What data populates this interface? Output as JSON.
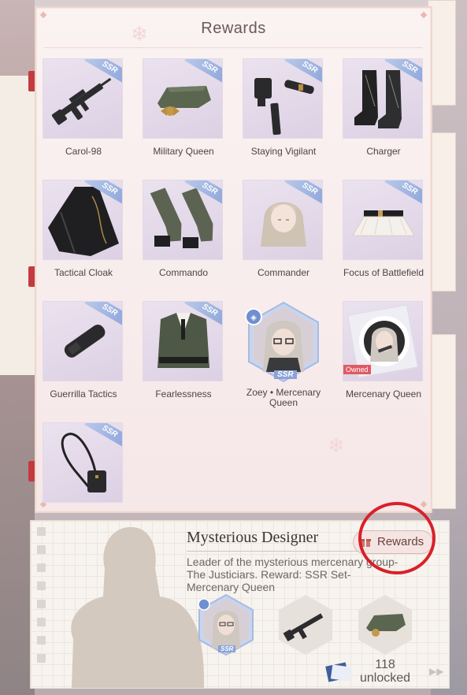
{
  "panel": {
    "title": "Rewards"
  },
  "rewards": [
    {
      "label": "Carol-98",
      "badge": "SSR",
      "icon": "rifle-icon"
    },
    {
      "label": "Military Queen",
      "badge": "SSR",
      "icon": "military-cap-icon"
    },
    {
      "label": "Staying Vigilant",
      "badge": "SSR",
      "icon": "belt-holster-icon"
    },
    {
      "label": "Charger",
      "badge": "SSR",
      "icon": "combat-boots-icon"
    },
    {
      "label": "Tactical Cloak",
      "badge": "SSR",
      "icon": "cloak-icon"
    },
    {
      "label": "Commando",
      "badge": "SSR",
      "icon": "gloves-icon"
    },
    {
      "label": "Commander",
      "badge": "SSR",
      "icon": "hair-icon"
    },
    {
      "label": "Focus of Battlefield",
      "badge": "SSR",
      "icon": "skirt-icon"
    },
    {
      "label": "Guerrilla Tactics",
      "badge": "SSR",
      "icon": "knife-holster-icon"
    },
    {
      "label": "Fearlessness",
      "badge": "SSR",
      "icon": "jacket-icon"
    },
    {
      "label": "Zoey • Mercenary Queen",
      "badge": "SSR",
      "icon": "character-portrait-icon"
    },
    {
      "label": "Mercenary Queen",
      "badge": "Owned",
      "icon": "pose-portrait-icon"
    },
    {
      "label": "",
      "badge": "SSR",
      "icon": "shoulder-bag-icon"
    }
  ],
  "designer": {
    "name": "Mysterious Designer",
    "rewards_button": "Rewards",
    "description": "Leader of the mysterious mercenary group-The Justiciars. Reward: SSR Set-Mercenary Queen",
    "unlocked_count": "118",
    "unlocked_label": "unlocked",
    "preview_badge": "SSR"
  },
  "colors": {
    "highlight_circle": "#d9202a",
    "ssr_badge": "#8aa3d8",
    "owned_badge": "#e05a62"
  }
}
